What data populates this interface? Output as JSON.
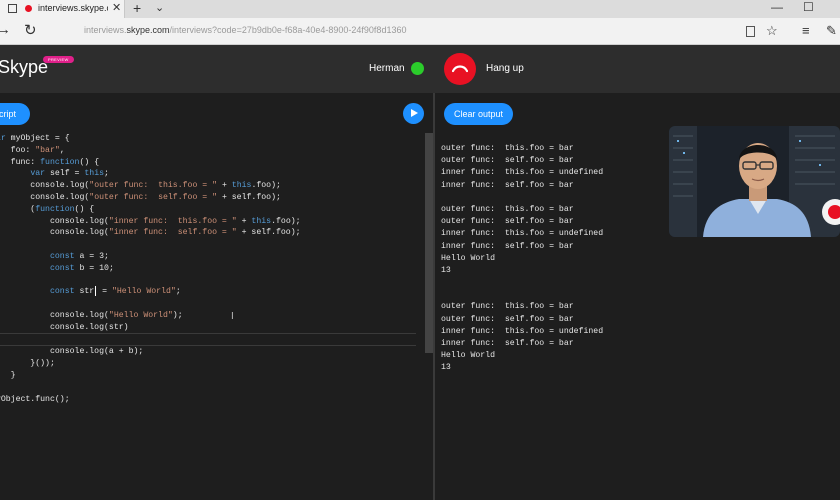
{
  "browser": {
    "tab_title": "interviews.skype.co",
    "url_prefix": "interviews.",
    "url_domain": "skype.com",
    "url_path": "/interviews?code=27b9db0e-f68a-40e4-8900-24f90f8d1360",
    "icons": [
      "page-icon",
      "recording-dot-icon",
      "close-icon",
      "new-tab-icon",
      "chevron-down-icon",
      "back-icon",
      "forward-icon",
      "refresh-icon",
      "reading-view-icon",
      "favorite-star-icon",
      "hub-icon",
      "notes-icon",
      "more-icon"
    ]
  },
  "header": {
    "logo": "Skype",
    "badge": "PREVIEW",
    "caller_name": "Herman",
    "hangup_label": "Hang up",
    "colors": {
      "online": "#2bcc2b",
      "hangup": "#e81123",
      "accent": "#1e90ff",
      "badge": "#e0208a"
    }
  },
  "editor": {
    "language_button": "JavaScript",
    "run_icon": "play-icon",
    "lines": [
      "var myObject = {",
      "    foo: \"bar\",",
      "    func: function() {",
      "        var self = this;",
      "        console.log(\"outer func:  this.foo = \" + this.foo);",
      "        console.log(\"outer func:  self.foo = \" + self.foo);",
      "        (function() {",
      "            console.log(\"inner func:  this.foo = \" + this.foo);",
      "            console.log(\"inner func:  self.foo = \" + self.foo);",
      "",
      "            const a = 3;",
      "            const b = 10;",
      "",
      "            const str = \"Hello World\";",
      "",
      "            console.log(\"Hello World\");",
      "            console.log(str)",
      "",
      "            console.log(a + b);",
      "        }());",
      "    }",
      "};",
      "myObject.func();"
    ]
  },
  "output": {
    "clear_button": "Clear output",
    "lines": [
      "outer func:  this.foo = bar",
      "outer func:  self.foo = bar",
      "inner func:  this.foo = undefined",
      "inner func:  self.foo = bar",
      "",
      "outer func:  this.foo = bar",
      "outer func:  self.foo = bar",
      "inner func:  this.foo = undefined",
      "inner func:  self.foo = bar",
      "Hello World",
      "13",
      "",
      "",
      "outer func:  this.foo = bar",
      "outer func:  self.foo = bar",
      "inner func:  this.foo = undefined",
      "inner func:  self.foo = bar",
      "Hello World",
      "13"
    ]
  }
}
